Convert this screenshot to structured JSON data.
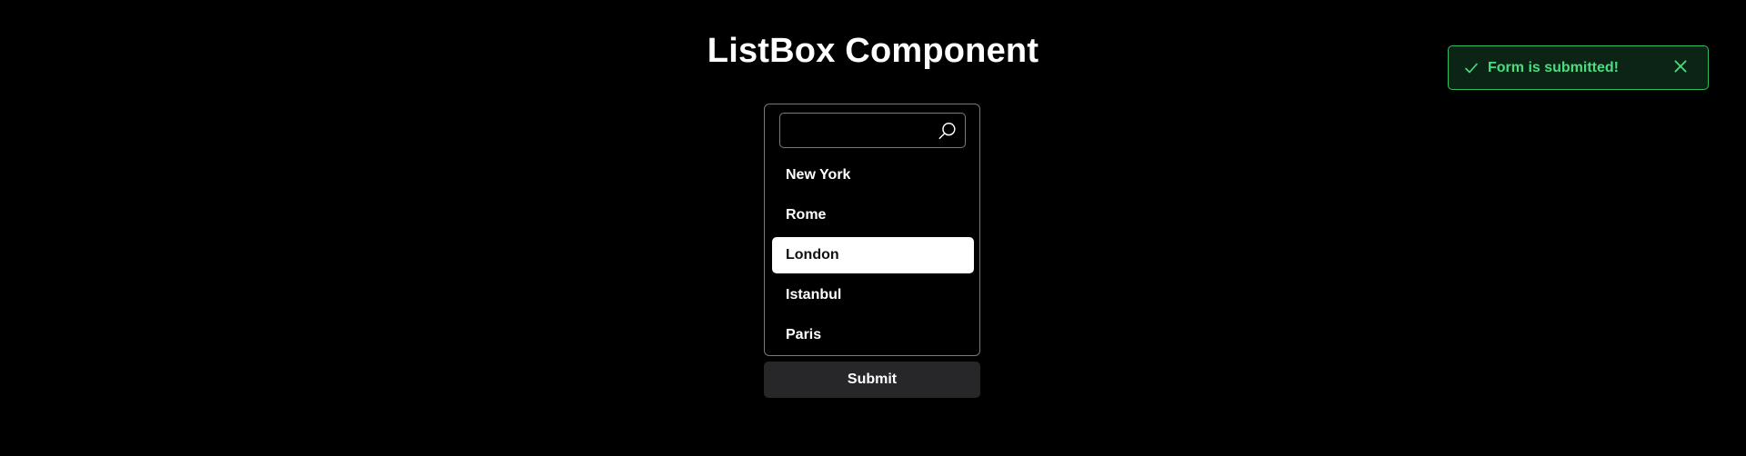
{
  "page": {
    "title": "ListBox Component"
  },
  "listbox": {
    "search": {
      "value": "",
      "placeholder": ""
    },
    "options": [
      {
        "label": "New York",
        "selected": false
      },
      {
        "label": "Rome",
        "selected": false
      },
      {
        "label": "London",
        "selected": true
      },
      {
        "label": "Istanbul",
        "selected": false
      },
      {
        "label": "Paris",
        "selected": false
      }
    ]
  },
  "form": {
    "submit_label": "Submit"
  },
  "toast": {
    "message": "Form is submitted!",
    "status": "success",
    "icon": "check-icon",
    "close_icon": "close-icon"
  },
  "colors": {
    "background": "#000000",
    "selected_option_bg": "#ffffff",
    "button_bg": "#27272a",
    "toast_accent": "#4ade80",
    "toast_border": "#2fbf5f",
    "toast_bg": "#0b2415"
  }
}
